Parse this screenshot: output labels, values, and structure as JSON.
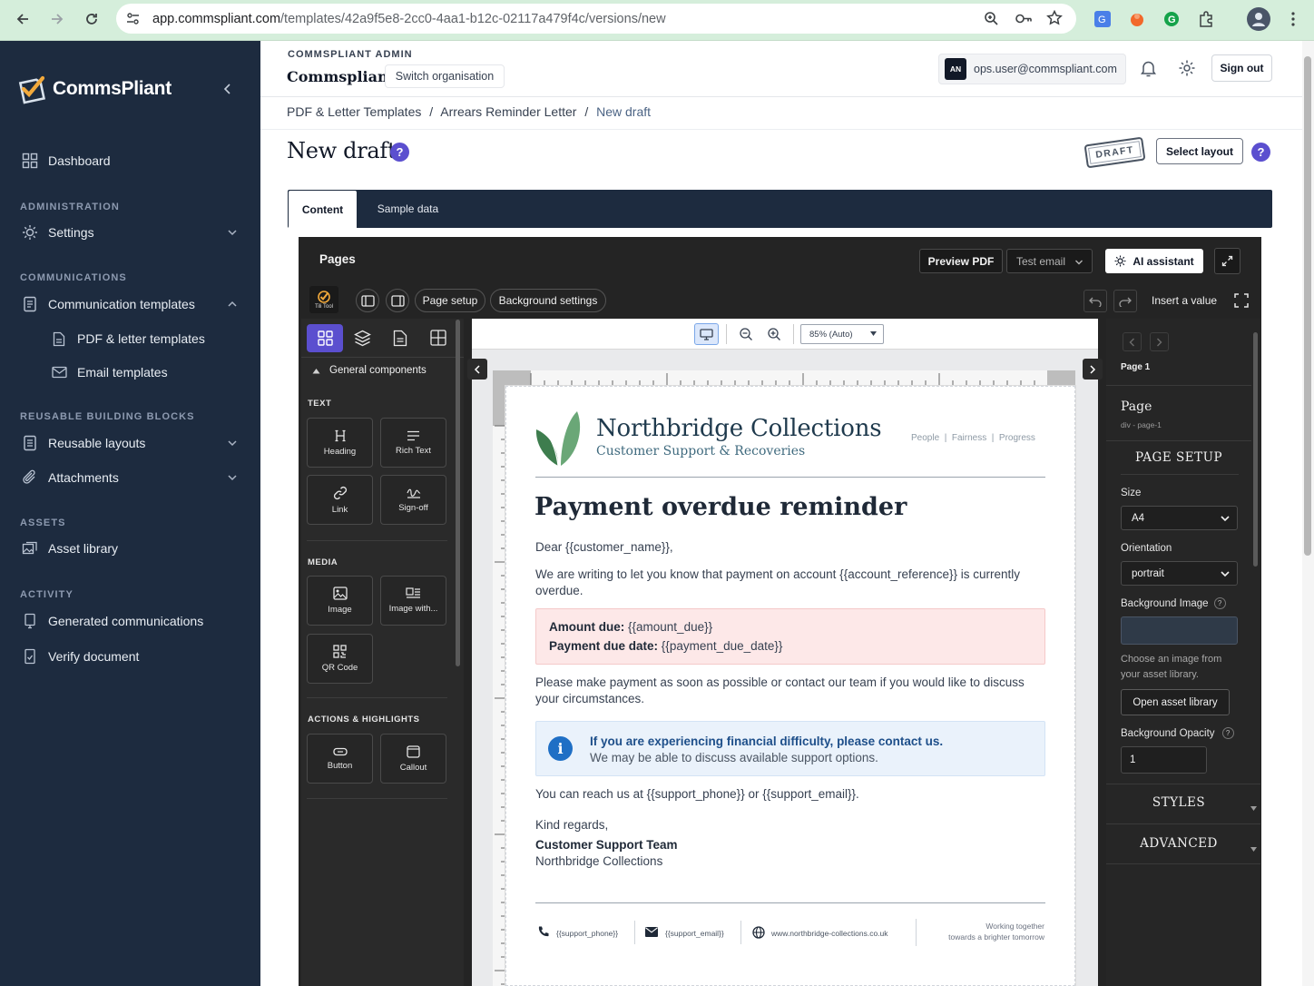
{
  "browser": {
    "url_host": "app.commspliant.com",
    "url_path": "/templates/42a9f5e8-2cc0-4aa1-b12c-02117a479f4c/versions/new"
  },
  "sidebar": {
    "brand": "CommsPliant",
    "dashboard": "Dashboard",
    "sections": {
      "administration": "ADMINISTRATION",
      "communications": "COMMUNICATIONS",
      "reusable": "REUSABLE BUILDING BLOCKS",
      "assets": "ASSETS",
      "activity": "ACTIVITY"
    },
    "settings": "Settings",
    "communication_templates": "Communication templates",
    "pdf_letter_templates": "PDF & letter templates",
    "email_templates": "Email templates",
    "reusable_layouts": "Reusable layouts",
    "attachments": "Attachments",
    "asset_library": "Asset library",
    "generated_communications": "Generated communications",
    "verify_document": "Verify document"
  },
  "header": {
    "org_label": "COMMSPLIANT ADMIN",
    "org_name": "Commspliant",
    "switch_org": "Switch organisation",
    "user_initials": "AN",
    "user_email": "ops.user@commspliant.com",
    "sign_out": "Sign out"
  },
  "breadcrumb": {
    "first": "PDF & Letter Templates",
    "second": "Arrears Reminder Letter",
    "current": "New draft",
    "sep": "/"
  },
  "page": {
    "title": "New draft",
    "draft_stamp": "DRAFT",
    "select_layout": "Select layout",
    "help": "?"
  },
  "tabs": {
    "content": "Content",
    "sample_data": "Sample data"
  },
  "editor": {
    "pages_label": "Pages",
    "preview_pdf": "Preview PDF",
    "test_email": "Test email",
    "ai_assistant": "AI assistant",
    "page_setup_btn": "Page setup",
    "background_settings": "Background settings",
    "insert_value": "Insert a value",
    "logo_caption": "Tili Tool",
    "zoom": "85% (Auto)",
    "general_components": "General components",
    "groups": {
      "text": "TEXT",
      "media": "MEDIA",
      "actions": "ACTIONS & HIGHLIGHTS"
    },
    "components": {
      "heading": "Heading",
      "rich_text": "Rich Text",
      "link": "Link",
      "sign_off": "Sign-off",
      "image": "Image",
      "image_with": "Image with...",
      "qr_code": "QR Code",
      "button": "Button",
      "callout": "Callout"
    }
  },
  "props": {
    "page_indicator": "Page 1",
    "element_name": "Page",
    "element_path": "div - page-1",
    "section_page_setup": "PAGE SETUP",
    "size_label": "Size",
    "size_value": "A4",
    "orientation_label": "Orientation",
    "orientation_value": "portrait",
    "bg_image_label": "Background Image",
    "bg_image_hint": "Choose an image from your asset library.",
    "open_asset_library": "Open asset library",
    "bg_opacity_label": "Background Opacity",
    "bg_opacity_value": "1",
    "styles": "STYLES",
    "advanced": "ADVANCED",
    "help": "?"
  },
  "letter": {
    "company": "Northbridge Collections",
    "tagline": "Customer Support & Recoveries",
    "values": "People  |  Fairness  |  Progress",
    "heading": "Payment overdue reminder",
    "greeting": "Dear {{customer_name}},",
    "intro_1": "We are writing to let you know that payment on account {{account_reference}} is currently",
    "intro_2": "overdue.",
    "amount_label": "Amount due:",
    "amount_value": "{{amount_due}}",
    "due_label": "Payment due date:",
    "due_value": "{{payment_due_date}}",
    "please_1": "Please make payment as soon as possible or contact our team if you would like to discuss",
    "please_2": "your circumstances.",
    "info_title": "If you are experiencing financial difficulty, please contact us.",
    "info_body": "We may be able to discuss available support options.",
    "reach": "You can reach us at {{support_phone}} or {{support_email}}.",
    "regards": "Kind regards,",
    "team": "Customer Support Team",
    "company_sign": "Northbridge Collections",
    "footer_phone": "{{support_phone}}",
    "footer_email": "{{support_email}}",
    "footer_web": "www.northbridge-collections.co.uk",
    "footer_slogan_1": "Working together",
    "footer_slogan_2": "towards a brighter tomorrow"
  },
  "colors": {
    "sidebar_bg": "#1d2b3f",
    "accent_purple": "#5b4fcf",
    "letter_green": "#3e7d4e",
    "alert_pink": "#fde8e8",
    "info_blue": "#e8f1fb"
  }
}
